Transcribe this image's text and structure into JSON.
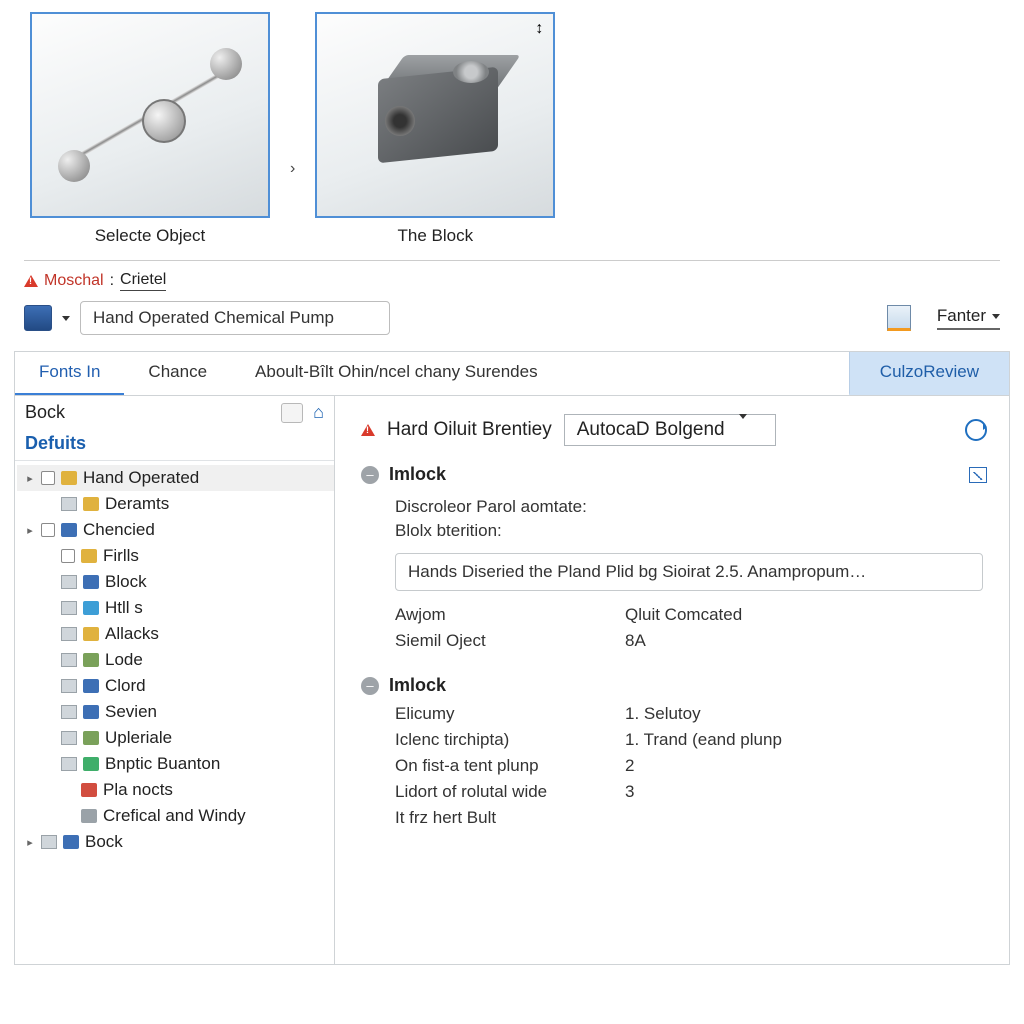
{
  "thumbnails": [
    {
      "caption": "Selecte Object"
    },
    {
      "caption": "The Block"
    }
  ],
  "thumbSeparator": "›",
  "warning": {
    "label": "Moschal",
    "value": "Crietel"
  },
  "search": {
    "value": "Hand Operated Chemical Pump"
  },
  "rightLink": "Fanter",
  "tabs": {
    "fonts": "Fonts In",
    "chance": "Chance",
    "about": "Aboult-Bîlt Ohin/ncel chany Surendes",
    "review": "CulzoReview"
  },
  "treeHeader": "Bock",
  "treeSection": "Defuits",
  "tree": [
    {
      "label": "Hand Operated",
      "depth": 0,
      "exp": "▸",
      "chk": true,
      "iconColor": "#e0b23e",
      "selected": true
    },
    {
      "label": "Deramts",
      "depth": 1,
      "pane": true,
      "iconColor": "#e0b23e"
    },
    {
      "label": "Chencied",
      "depth": 0,
      "exp": "▸",
      "chk": true,
      "iconColor": "#3d6fb5"
    },
    {
      "label": "Firlls",
      "depth": 1,
      "chk": true,
      "iconColor": "#e0b23e"
    },
    {
      "label": "Block",
      "depth": 1,
      "pane": true,
      "iconColor": "#3d6fb5"
    },
    {
      "label": "Htll s",
      "depth": 1,
      "pane": true,
      "iconColor": "#3d9ed6"
    },
    {
      "label": "Allacks",
      "depth": 1,
      "pane": true,
      "iconColor": "#e0b23e"
    },
    {
      "label": "Lode",
      "depth": 1,
      "pane": true,
      "iconColor": "#7aa15a"
    },
    {
      "label": "Clord",
      "depth": 1,
      "pane": true,
      "iconColor": "#3d6fb5"
    },
    {
      "label": "Sevien",
      "depth": 1,
      "pane": true,
      "iconColor": "#3d6fb5"
    },
    {
      "label": "Upleriale",
      "depth": 1,
      "pane": true,
      "iconColor": "#7aa15a"
    },
    {
      "label": "Bnptic Buanton",
      "depth": 1,
      "pane": true,
      "iconColor": "#3fae6a"
    },
    {
      "label": "Pla nocts",
      "depth": 2,
      "iconColor": "#d24d3f"
    },
    {
      "label": "Crefical and Windy",
      "depth": 2,
      "iconColor": "#9aa2a8"
    },
    {
      "label": "Bock",
      "depth": 0,
      "exp": "▸",
      "pane": true,
      "iconColor": "#3d6fb5"
    }
  ],
  "detail": {
    "headTitle": "Hard Oiluit Brentiey",
    "headSelect": "AutocaD Bolgend",
    "section1": {
      "name": "Imlock",
      "line1": "Discroleor Parol aomtate:",
      "line2": "Blolx bterition:",
      "desc": "Hands Diseried the Pland Plid bg Sioirat 2.5. Anampropum…",
      "kv": [
        {
          "k": "Awjom",
          "v": "Qluit Comcated"
        },
        {
          "k": "Siemil Oject",
          "v": "8A"
        }
      ]
    },
    "section2": {
      "name": "Imlock",
      "kv": [
        {
          "k": "Elicumy",
          "v": "1. Selutoy"
        },
        {
          "k": "Iclenc tirchipta)",
          "v": "1. Trand (eand plunp"
        },
        {
          "k": "On fist-a tent plunp",
          "v": "2"
        },
        {
          "k": "Lidort of rolutal wide",
          "v": "3"
        },
        {
          "k": "It frz hert Bult",
          "v": ""
        }
      ]
    }
  }
}
